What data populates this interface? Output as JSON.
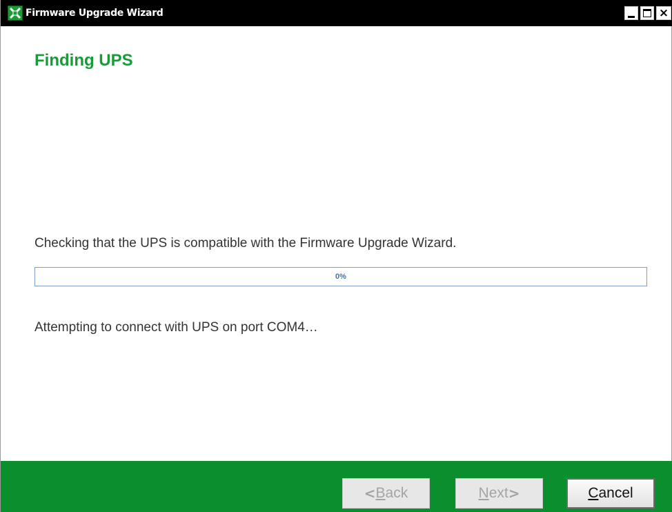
{
  "window": {
    "title": "Firmware Upgrade Wizard",
    "controls": {
      "minimize": "minimize-icon",
      "maximize": "maximize-icon",
      "close": "close-icon"
    },
    "app_icon": "wizard-app-icon"
  },
  "page": {
    "heading": "Finding UPS",
    "status_message": "Checking that the UPS is compatible with the Firmware Upgrade Wizard.",
    "progress": {
      "percent": 0,
      "label": "0%"
    },
    "detail_message": "Attempting to connect with UPS on port COM4…"
  },
  "footer": {
    "back": {
      "arrow": "<",
      "mnemonic": "B",
      "rest": "ack",
      "enabled": false
    },
    "next": {
      "mnemonic": "N",
      "rest": "ext",
      "arrow": ">",
      "enabled": false
    },
    "cancel": {
      "mnemonic": "C",
      "rest": "ancel",
      "enabled": true
    }
  },
  "colors": {
    "accent_green": "#1b9a3a",
    "footer_green": "#0b8f2e",
    "titlebar": "#000000"
  }
}
